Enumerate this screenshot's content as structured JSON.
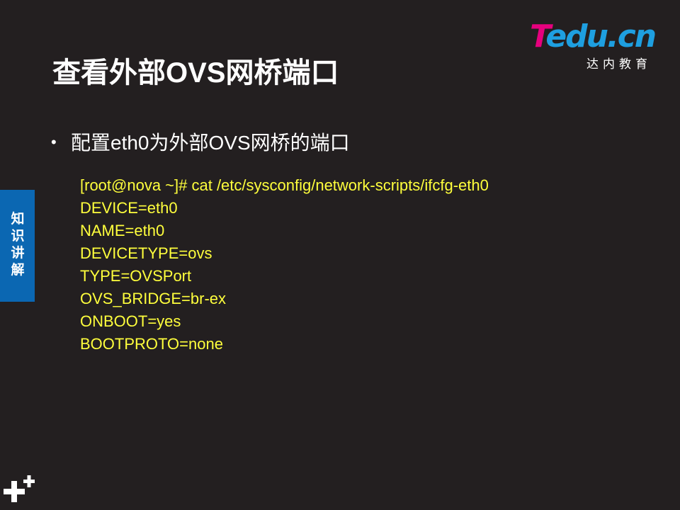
{
  "slide": {
    "title": "查看外部OVS网桥端口",
    "logo": {
      "brand_first": "T",
      "brand_rest": "edu.cn",
      "subtitle": "达内教育",
      "colors": {
        "t": "#e6007e",
        "rest": "#1e9fe0"
      }
    },
    "side_tab": {
      "label": "知识讲解",
      "color": "#0b67b2"
    },
    "bullet": {
      "symbol": "•",
      "text": "配置eth0为外部OVS网桥的端口"
    },
    "code_lines": [
      "[root@nova ~]# cat /etc/sysconfig/network-scripts/ifcfg-eth0",
      "DEVICE=eth0",
      "NAME=eth0",
      "DEVICETYPE=ovs",
      "TYPE=OVSPort",
      "OVS_BRIDGE=br-ex",
      "ONBOOT=yes",
      "BOOTPROTO=none"
    ],
    "code_color": "#ffff3c",
    "background_color": "#231f20",
    "corner_icon": "plus-plus-icon"
  }
}
